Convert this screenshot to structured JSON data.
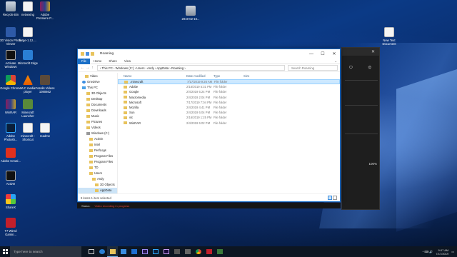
{
  "desktop": {
    "icons": [
      {
        "name": "recycle-bin",
        "label": "Recycle Bin",
        "glyph": "g-bin"
      },
      {
        "name": "netvexing",
        "label": "netvexing",
        "glyph": "g-file"
      },
      {
        "name": "adobe-premiere",
        "label": "Adobe Premiere P...",
        "glyph": "g-winrar"
      },
      {
        "name": "3d-vision-photo-viewer",
        "label": "3D Vision Photo Viewer",
        "glyph": "g-photo"
      },
      {
        "name": "forge",
        "label": "forge-1.12....",
        "glyph": "g-file"
      },
      {
        "name": "activate-windows",
        "label": "Activate Windows",
        "glyph": "g-activ"
      },
      {
        "name": "microsoft-edge",
        "label": "Microsoft Edge",
        "glyph": "g-edge"
      },
      {
        "name": "google-chrome",
        "label": "Google Chrome",
        "glyph": "g-chrome"
      },
      {
        "name": "vlc-media-player",
        "label": "VLC media player",
        "glyph": "g-vlc"
      },
      {
        "name": "fossils-videos",
        "label": "Fossils Videos 1080662",
        "glyph": "g-video"
      },
      {
        "name": "winrar",
        "label": "WinRAR",
        "glyph": "g-winrar"
      },
      {
        "name": "minecraft-launcher",
        "label": "Minecraft Launcher",
        "glyph": "g-mc"
      },
      {
        "name": "adobe-photoshop",
        "label": "Adobe Photosh...",
        "glyph": "g-ps"
      },
      {
        "name": "minecraft-shortcut",
        "label": "minecraft - Shortcut",
        "glyph": "g-file"
      },
      {
        "name": "readme",
        "label": "readme",
        "glyph": "g-file"
      },
      {
        "name": "adobe-creative",
        "label": "Adobe Creati...",
        "glyph": "g-adobe"
      },
      {
        "name": "activei",
        "label": "ActiveI",
        "glyph": "g-activ"
      },
      {
        "name": "sharex",
        "label": "ShareX",
        "glyph": "g-sharex"
      },
      {
        "name": "t7-wired",
        "label": "T7 Wired Gamin...",
        "glyph": "g-t7"
      },
      {
        "name": "screenshot-file",
        "label": "2019-02-16...",
        "glyph": "g-thumb"
      },
      {
        "name": "new-text-document",
        "label": "New Text Document",
        "glyph": "g-file"
      }
    ]
  },
  "bg_app": {
    "close": "✕",
    "percent": "100%"
  },
  "explorer": {
    "title": "Roaming",
    "controls": {
      "min": "—",
      "max": "☐",
      "close": "✕"
    },
    "ribbon": {
      "file": "File",
      "home": "Home",
      "share": "Share",
      "view": "View",
      "chevron": "⌄"
    },
    "address": {
      "back": "←",
      "forward": "→",
      "up": "↑",
      "path": "›  This PC  ›  Windows (C:)  ›  Users  ›  Andy  ›  AppData  ›  Roaming  ›",
      "search_placeholder": "Search Roaming"
    },
    "nav": [
      {
        "label": "Video",
        "icon": "fi",
        "indent": 10
      },
      {
        "label": "OneDrive",
        "icon": "ci",
        "indent": 6
      },
      {
        "label": "This PC",
        "icon": "pi",
        "indent": 6
      },
      {
        "label": "3D Objects",
        "icon": "fi",
        "indent": 12
      },
      {
        "label": "Desktop",
        "icon": "fi",
        "indent": 12
      },
      {
        "label": "Documents",
        "icon": "fi",
        "indent": 12
      },
      {
        "label": "Downloads",
        "icon": "fi",
        "indent": 12
      },
      {
        "label": "Music",
        "icon": "fi",
        "indent": 12
      },
      {
        "label": "Pictures",
        "icon": "fi",
        "indent": 12
      },
      {
        "label": "Videos",
        "icon": "fi",
        "indent": 12
      },
      {
        "label": "Windows (C:)",
        "icon": "di",
        "indent": 12
      },
      {
        "label": "Activin",
        "icon": "fi",
        "indent": 16
      },
      {
        "label": "Intel",
        "icon": "fi",
        "indent": 16
      },
      {
        "label": "PerfLogs",
        "icon": "fi",
        "indent": 16
      },
      {
        "label": "Program Files",
        "icon": "fi",
        "indent": 16
      },
      {
        "label": "Program Files",
        "icon": "fi",
        "indent": 16
      },
      {
        "label": "TD",
        "icon": "fi",
        "indent": 16
      },
      {
        "label": "Users",
        "icon": "fi",
        "indent": 16
      },
      {
        "label": "Andy",
        "icon": "fi",
        "indent": 20
      },
      {
        "label": "3D Objects",
        "icon": "fi",
        "indent": 24
      },
      {
        "label": "AppData",
        "icon": "fi",
        "indent": 24,
        "selected": true
      }
    ],
    "columns": {
      "name": "Name",
      "date": "Date modified",
      "type": "Type",
      "size": "Size"
    },
    "files": [
      {
        "name": ".minecraft",
        "date": "7/17/2019 9:26 AM",
        "type": "File folder",
        "selected": true
      },
      {
        "name": "Adobe",
        "date": "2/16/2019 5:31 PM",
        "type": "File folder"
      },
      {
        "name": "Google",
        "date": "2/4/2019 5:24 PM",
        "type": "File folder"
      },
      {
        "name": "Macromedia",
        "date": "2/4/2019 2:04 PM",
        "type": "File folder"
      },
      {
        "name": "Microsoft",
        "date": "7/17/2019 7:04 PM",
        "type": "File folder"
      },
      {
        "name": "Mozilla",
        "date": "2/4/2019 4:41 PM",
        "type": "File folder"
      },
      {
        "name": "Sun",
        "date": "2/4/2019 5:04 PM",
        "type": "File folder"
      },
      {
        "name": "vlc",
        "date": "2/16/2019 1:25 PM",
        "type": "File folder"
      },
      {
        "name": "WinRAR",
        "date": "2/4/2019 5:02 PM",
        "type": "File folder"
      }
    ],
    "status": "9 items    1 item selected"
  },
  "recorder": {
    "label": "Status:",
    "value": "Video recording in progress"
  },
  "taskbar": {
    "search_placeholder": "Type here to search",
    "time": "9:07 AM",
    "date": "7/17/2019",
    "tray_text": "^  ⌨  🔊"
  }
}
